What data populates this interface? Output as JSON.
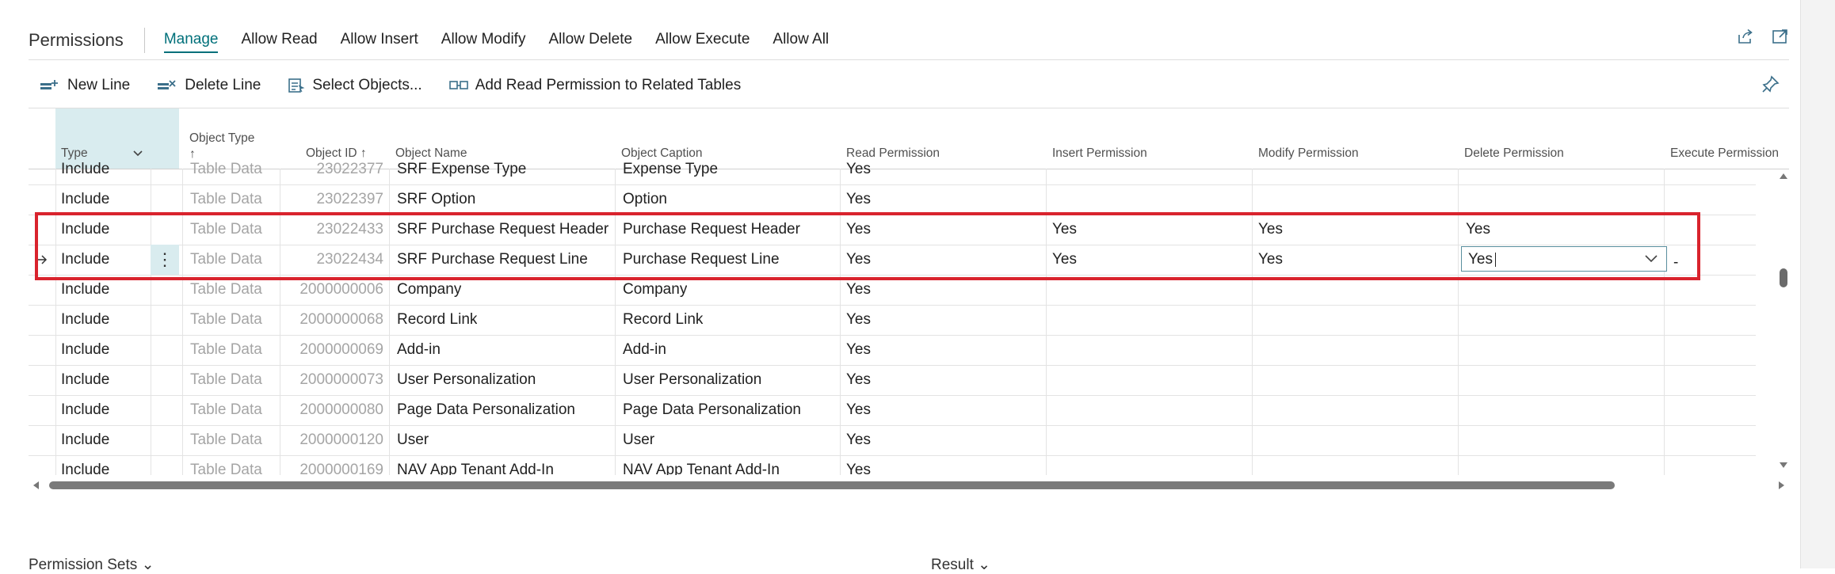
{
  "header": {
    "title": "Permissions",
    "nav": [
      "Manage",
      "Allow Read",
      "Allow Insert",
      "Allow Modify",
      "Allow Delete",
      "Allow Execute",
      "Allow All"
    ],
    "active_nav": "Manage",
    "icons": [
      "share-icon",
      "expand-icon"
    ]
  },
  "actions": {
    "new_line": "New Line",
    "delete_line": "Delete Line",
    "select_objects": "Select Objects...",
    "add_read_permission": "Add Read Permission to Related Tables"
  },
  "table": {
    "columns": {
      "type": "Type",
      "object_type": "Object Type",
      "object_type_sort": "↑",
      "object_id": "Object ID",
      "object_id_sort": "↑",
      "object_name": "Object Name",
      "object_caption": "Object Caption",
      "read": "Read Permission",
      "insert": "Insert Permission",
      "modify": "Modify Permission",
      "delete": "Delete Permission",
      "execute": "Execute Permission"
    },
    "rows": [
      {
        "type": "Include",
        "object_type": "Table Data",
        "object_id": "23022377",
        "object_name": "SRF Expense Type",
        "object_caption": "Expense Type",
        "read": "Yes",
        "insert": "",
        "modify": "",
        "delete": ""
      },
      {
        "type": "Include",
        "object_type": "Table Data",
        "object_id": "23022397",
        "object_name": "SRF Option",
        "object_caption": "Option",
        "read": "Yes",
        "insert": "",
        "modify": "",
        "delete": ""
      },
      {
        "type": "Include",
        "object_type": "Table Data",
        "object_id": "23022433",
        "object_name": "SRF Purchase Request Header",
        "object_caption": "Purchase Request Header",
        "read": "Yes",
        "insert": "Yes",
        "modify": "Yes",
        "delete": "Yes"
      },
      {
        "type": "Include",
        "object_type": "Table Data",
        "object_id": "23022434",
        "object_name": "SRF Purchase Request Line",
        "object_caption": "Purchase Request Line",
        "read": "Yes",
        "insert": "Yes",
        "modify": "Yes",
        "delete": "Yes",
        "execute": "-"
      },
      {
        "type": "Include",
        "object_type": "Table Data",
        "object_id": "2000000006",
        "object_name": "Company",
        "object_caption": "Company",
        "read": "Yes",
        "insert": "",
        "modify": "",
        "delete": ""
      },
      {
        "type": "Include",
        "object_type": "Table Data",
        "object_id": "2000000068",
        "object_name": "Record Link",
        "object_caption": "Record Link",
        "read": "Yes",
        "insert": "",
        "modify": "",
        "delete": ""
      },
      {
        "type": "Include",
        "object_type": "Table Data",
        "object_id": "2000000069",
        "object_name": "Add-in",
        "object_caption": "Add-in",
        "read": "Yes",
        "insert": "",
        "modify": "",
        "delete": ""
      },
      {
        "type": "Include",
        "object_type": "Table Data",
        "object_id": "2000000073",
        "object_name": "User Personalization",
        "object_caption": "User Personalization",
        "read": "Yes",
        "insert": "",
        "modify": "",
        "delete": ""
      },
      {
        "type": "Include",
        "object_type": "Table Data",
        "object_id": "2000000080",
        "object_name": "Page Data Personalization",
        "object_caption": "Page Data Personalization",
        "read": "Yes",
        "insert": "",
        "modify": "",
        "delete": ""
      },
      {
        "type": "Include",
        "object_type": "Table Data",
        "object_id": "2000000120",
        "object_name": "User",
        "object_caption": "User",
        "read": "Yes",
        "insert": "",
        "modify": "",
        "delete": ""
      },
      {
        "type": "Include",
        "object_type": "Table Data",
        "object_id": "2000000169",
        "object_name": "NAV App Tenant Add-In",
        "object_caption": "NAV App Tenant Add-In",
        "read": "Yes",
        "insert": "",
        "modify": "",
        "delete": ""
      }
    ],
    "selected_row": 3,
    "editing_cell": "delete"
  },
  "footer": {
    "permission_sets": "Permission Sets",
    "result": "Result"
  },
  "colors": {
    "accent": "#00707a",
    "highlight_border": "#d9232d",
    "selected_column_bg": "#d9ecef"
  }
}
